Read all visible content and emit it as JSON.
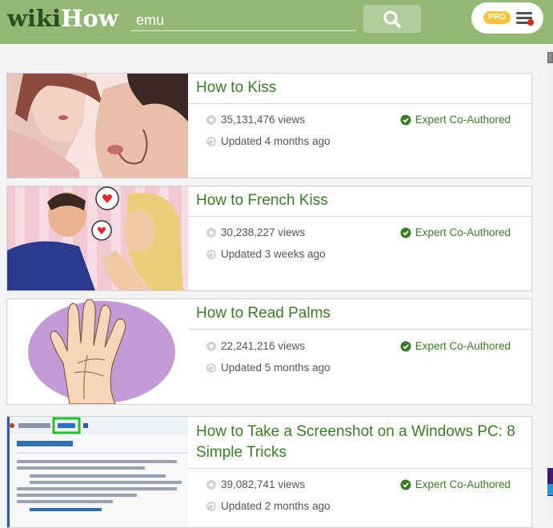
{
  "header": {
    "logo_wiki": "wiki",
    "logo_how": "How",
    "search_value": "emu",
    "pro_badge": "PRO"
  },
  "colors": {
    "header_bg": "#93b874",
    "title_green": "#3a7c26",
    "pro_yellow": "#fbc43a",
    "notify_red": "#e0261c"
  },
  "icons": {
    "search": "magnifier-icon",
    "menu": "hamburger-icon",
    "views": "eye-icon",
    "updated": "refresh-icon",
    "expert": "checkmark-badge-icon"
  },
  "articles": [
    {
      "title": "How to Kiss",
      "views": "35,131,476 views",
      "updated": "Updated 4 months ago",
      "badge": "Expert Co-Authored"
    },
    {
      "title": "How to French Kiss",
      "views": "30,238,227 views",
      "updated": "Updated 3 weeks ago",
      "badge": "Expert Co-Authored"
    },
    {
      "title": "How to Read Palms",
      "views": "22,241,216 views",
      "updated": "Updated 5 months ago",
      "badge": "Expert Co-Authored"
    },
    {
      "title": "How to Take a Screenshot on a Windows PC: 8 Simple Tricks",
      "views": "39,082,741 views",
      "updated": "Updated 2 months ago",
      "badge": "Expert Co-Authored"
    }
  ]
}
